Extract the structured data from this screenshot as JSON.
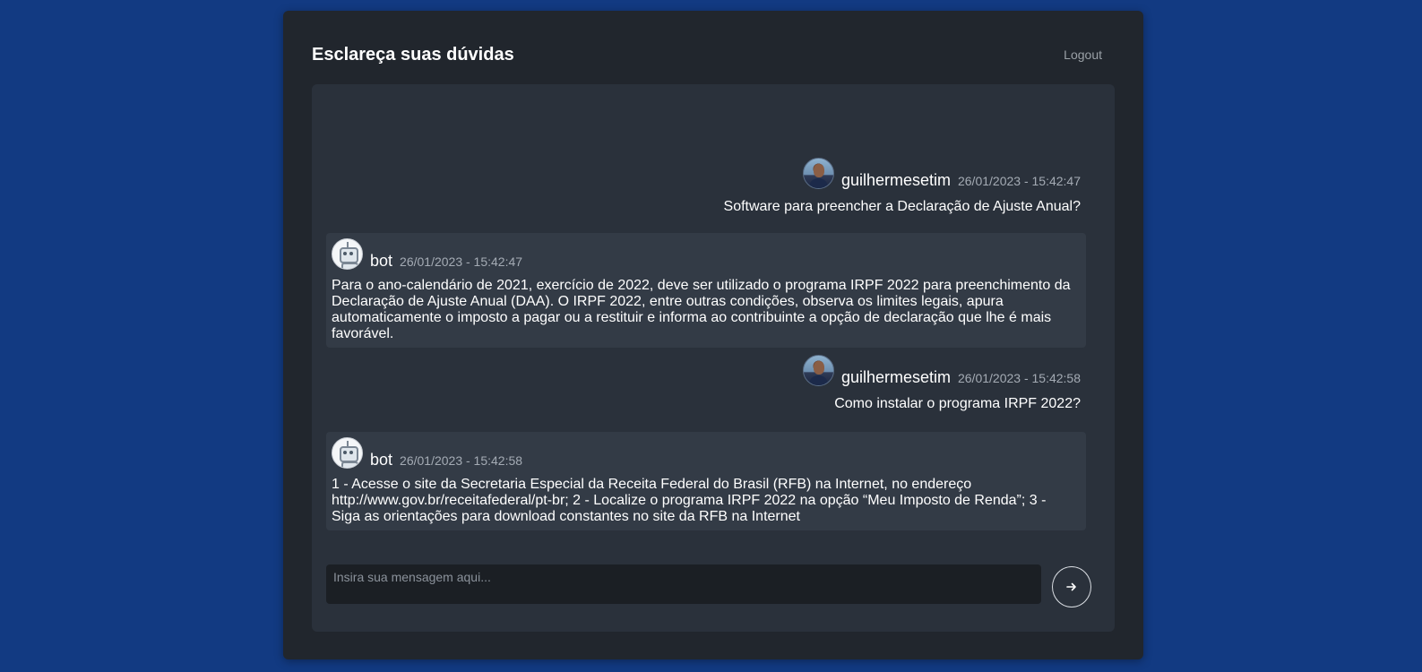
{
  "header": {
    "title": "Esclareça suas dúvidas",
    "logout_label": "Logout"
  },
  "messages": [
    {
      "sender": "guilhermesetim",
      "role": "user",
      "timestamp": "26/01/2023 - 15:42:47",
      "text": "Software para preencher a Declaração de Ajuste Anual?"
    },
    {
      "sender": "bot",
      "role": "bot",
      "timestamp": "26/01/2023 - 15:42:47",
      "text": "Para o ano-calendário de 2021, exercício de 2022, deve ser utilizado o programa IRPF 2022 para preenchimento da Declaração de Ajuste Anual (DAA). O IRPF 2022, entre outras condições, observa os limites legais, apura automaticamente o imposto a pagar ou a restituir e informa ao contribuinte a opção de declaração que lhe é mais favorável."
    },
    {
      "sender": "guilhermesetim",
      "role": "user",
      "timestamp": "26/01/2023 - 15:42:58",
      "text": "Como instalar o programa IRPF 2022?"
    },
    {
      "sender": "bot",
      "role": "bot",
      "timestamp": "26/01/2023 - 15:42:58",
      "text": "1 - Acesse o site da Secretaria Especial da Receita Federal do Brasil (RFB) na Internet, no endereço http://www.gov.br/receitafederal/pt-br; 2 - Localize o programa IRPF 2022 na opção “Meu Imposto de Renda”; 3 - Siga as orientações para download constantes no site da RFB na Internet"
    }
  ],
  "composer": {
    "placeholder": "Insira sua mensagem aqui...",
    "value": "",
    "send_icon": "arrow-right-icon"
  },
  "colors": {
    "page_background": "#123a82",
    "card_background": "#21262d",
    "chat_background": "#2a313b",
    "bot_bubble": "#333b46",
    "input_background": "#1b1f24"
  }
}
